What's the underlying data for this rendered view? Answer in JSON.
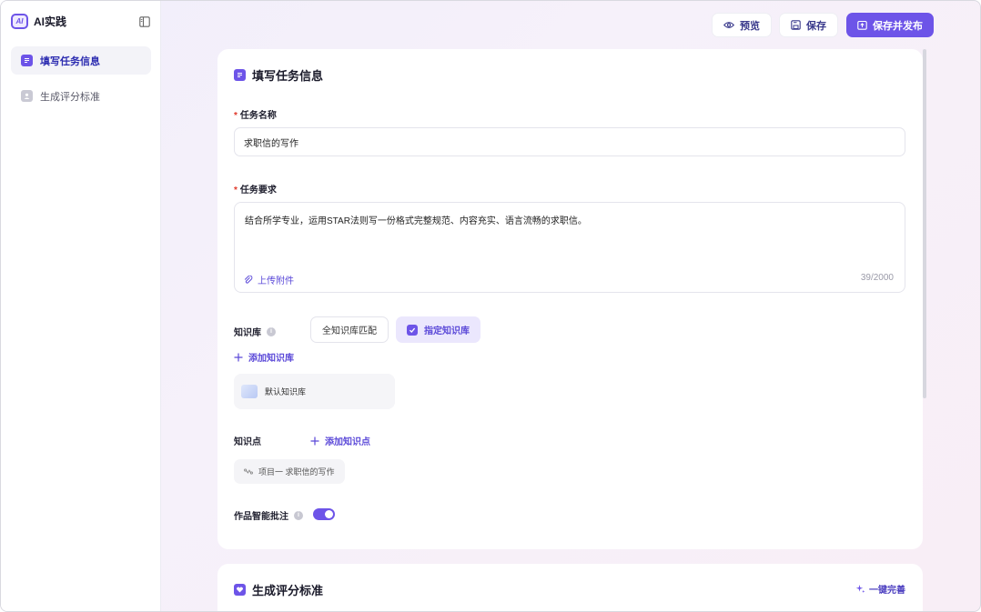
{
  "brand": {
    "logo_text": "AI",
    "title": "AI实践"
  },
  "sidebar": {
    "items": [
      {
        "label": "填写任务信息",
        "active": true,
        "icon": "document-icon"
      },
      {
        "label": "生成评分标准",
        "active": false,
        "icon": "user-card-icon"
      }
    ]
  },
  "toolbar": {
    "preview_label": "预览",
    "save_label": "保存",
    "save_publish_label": "保存并发布"
  },
  "task_card": {
    "title": "填写任务信息",
    "name_label": "任务名称",
    "name_value": "求职信的写作",
    "req_label": "任务要求",
    "req_value": "结合所学专业，运用STAR法则写一份格式完整规范、内容充实、语言流畅的求职信。",
    "upload_label": "上传附件",
    "char_count": "39/2000",
    "kb_label": "知识库",
    "kb_opt_all": "全知识库匹配",
    "kb_opt_specified": "指定知识库",
    "add_kb": "添加知识库",
    "kb_item": "默认知识库",
    "kp_label": "知识点",
    "add_kp": "添加知识点",
    "kp_item": "项目一 求职信的写作",
    "smart_label": "作品智能批注",
    "smart_enabled": true,
    "required_mark": "*"
  },
  "rubric_card": {
    "title": "生成评分标准",
    "one_click": "一键完善"
  },
  "colors": {
    "accent": "#6d54e8",
    "required": "#e0392b"
  }
}
